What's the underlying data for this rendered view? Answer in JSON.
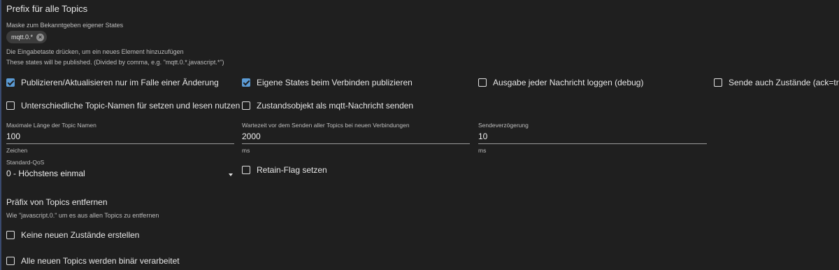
{
  "prefix_section": {
    "title": "Prefix für alle Topics",
    "mask_label": "Maske zum Bekanntgeben eigener States",
    "chip_value": "mqtt.0.*",
    "enter_hint": "Die Eingabetaste drücken, um ein neues Element hinzuzufügen",
    "published_hint": "These states will be published. (Divided by comma, e.g. \"mqtt.0.*,javascript.*\")"
  },
  "checkboxes": {
    "publish_on_change": {
      "label": "Publizieren/Aktualisieren nur im Falle einer Änderung",
      "checked": true
    },
    "publish_own_states": {
      "label": "Eigene States beim Verbinden publizieren",
      "checked": true
    },
    "log_each_message": {
      "label": "Ausgabe jeder Nachricht loggen (debug)",
      "checked": false
    },
    "send_ack_true": {
      "label": "Sende auch Zustände (ack=true)",
      "checked": false
    },
    "different_topic_names": {
      "label": "Unterschiedliche Topic-Namen für setzen und lesen nutzen",
      "checked": false
    },
    "state_object_as_message": {
      "label": "Zustandsobjekt als mqtt-Nachricht senden",
      "checked": false
    },
    "retain_flag": {
      "label": "Retain-Flag setzen",
      "checked": false
    },
    "no_new_states": {
      "label": "Keine neuen Zustände erstellen",
      "checked": false
    },
    "all_topics_binary": {
      "label": "Alle neuen Topics werden binär verarbeitet",
      "checked": false
    }
  },
  "fields": {
    "max_topic_length": {
      "label": "Maximale Länge der Topic Namen",
      "value": "100",
      "unit": "Zeichen"
    },
    "wait_before_send": {
      "label": "Wartezeit vor dem Senden aller Topics bei neuen Verbindungen",
      "value": "2000",
      "unit": "ms"
    },
    "send_delay": {
      "label": "Sendeverzögerung",
      "value": "10",
      "unit": "ms"
    },
    "default_qos": {
      "label": "Standard-QoS",
      "value": "0 - Höchstens einmal"
    }
  },
  "remove_prefix_section": {
    "title": "Präfix von Topics entfernen",
    "hint": "Wie \"javascript.0.\" um es aus allen Topics zu entfernen"
  },
  "colors": {
    "background": "#1f1f1f",
    "accent": "#5b9bd5"
  }
}
